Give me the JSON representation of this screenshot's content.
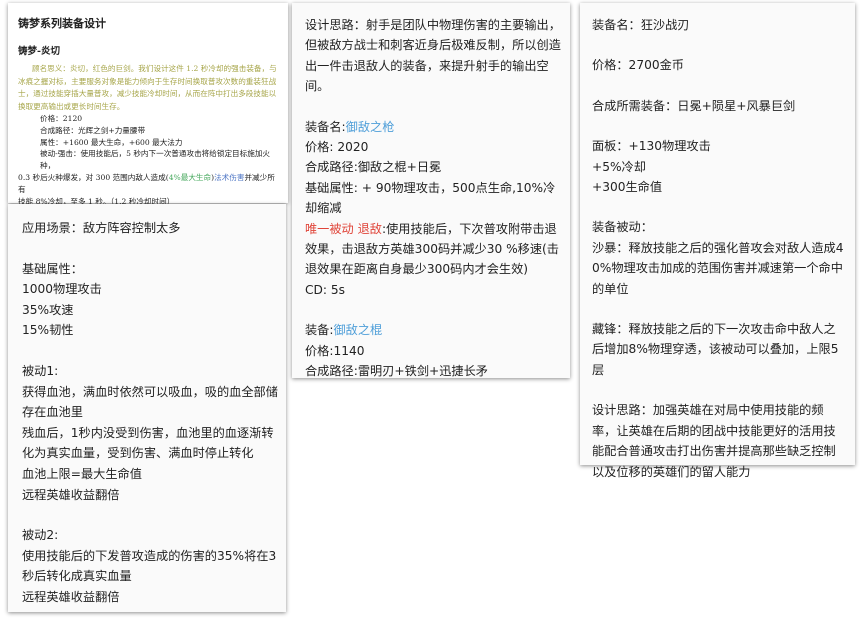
{
  "card1": {
    "title": "铸梦系列装备设计",
    "subtitle": "铸梦-炎切",
    "olive_lines": [
      "顾名思义：炎切，红色的巨剑。我们设计这件 1.2 秒冷却的强击装备，与",
      "冰痕之握对标，主要服务对象是能力倾向于生存时间换取普攻次数的重装狂战",
      "士，通过技能穿插大量普攻，减少技能冷却时间，从而在阵中打出多段技能以",
      "换取更高输出或更长时间生存。"
    ],
    "price": "价格：2120",
    "recipe": "合成路径：光辉之剑+力量腰带",
    "attrs": "属性：+1600 最大生命，+600 最大法力",
    "passive_a": "被动-强击：使用技能后，5 秒内下一次普通攻击将给锁定目标施加火种，",
    "passive_b_pre": "0.3 秒后火种爆发，对 300 范围内敌人造成(",
    "passive_b_green": "4%最大生命",
    "passive_b_post": ")",
    "passive_b_blue": "法术伤害",
    "passive_b_tail": "并减少所有",
    "passive_c": "技能 8%冷却，至多 1 秒。（1.2 秒冷却时间）"
  },
  "card2": {
    "lines": [
      "应用场景：敌方阵容控制太多",
      "",
      "基础属性：",
      "1000物理攻击",
      "35%攻速",
      "15%韧性",
      "",
      "被动1:",
      "获得血池，满血时依然可以吸血，吸的血全部储",
      "存在血池里",
      "残血后，1秒内没受到伤害，血池里的血逐渐转",
      "化为真实血量，受到伤害、满血时停止转化",
      "血池上限=最大生命值",
      "远程英雄收益翻倍",
      "",
      "被动2:",
      "使用技能后的下发普攻造成的伤害的35%将在3",
      "秒后转化成真实血量",
      "远程英雄收益翻倍"
    ]
  },
  "card3": {
    "intro": "设计思路：射手是团队中物理伤害的主要输出，但被敌方战士和刺客近身后极难反制，所以创造出一件击退敌人的装备，来提升射手的输出空间。",
    "item1_label": "装备名:",
    "item1_name": "御敌之枪",
    "item1_price": "价格: 2020",
    "item1_recipe": "合成路径:御敌之棍+日冕",
    "item1_attrs": "基础属性: + 90物理攻击，500点生命,10%冷却缩减",
    "item1_passive_tag": "唯一被动 退敌",
    "item1_passive_text": ":使用技能后，下次普攻附带击退效果，击退敌方英雄300码并减少30 %移速(击退效果在距离自身最少300码内才会生效)",
    "item1_cd": "CD: 5s",
    "item2_label": "装备:",
    "item2_name": "御敌之棍",
    "item2_price": "价格:1140",
    "item2_recipe": "合成路径:雷明刃+铁剑+迅捷长矛"
  },
  "card4": {
    "name": "装备名：狂沙战刃",
    "price": "价格：2700金币",
    "recipe": "合成所需装备：日冕+陨星+风暴巨剑",
    "panel_1": "面板：+130物理攻击",
    "panel_2": "+5%冷却",
    "panel_3": "+300生命值",
    "passive_title": "装备被动：",
    "passive_1": "沙暴：释放技能之后的强化普攻会对敌人造成40%物理攻击加成的范围伤害并减速第一个命中的单位",
    "passive_2": "藏锋：释放技能之后的下一次攻击命中敌人之后增加8%物理穿透，该被动可以叠加，上限5层",
    "design": "设计思路：加强英雄在对局中使用技能的频率，让英雄在后期的团战中技能更好的活用技能配合普通攻击打出伤害并提高那些缺乏控制以及位移的英雄们的留人能力"
  }
}
